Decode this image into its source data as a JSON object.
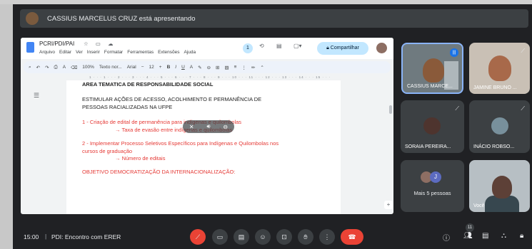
{
  "banner": {
    "text": "CASSIUS MARCELUS CRUZ está apresentando"
  },
  "doc": {
    "title": "PCRI/PDI/PAI",
    "menus": [
      "Arquivo",
      "Editar",
      "Ver",
      "Inserir",
      "Formatar",
      "Ferramentas",
      "Extensões",
      "Ajuda"
    ],
    "badge": "1",
    "share_label": "Compartilhar",
    "toolbar": {
      "zoom": "100%",
      "style": "Texto nor...",
      "font": "Arial",
      "size": "12"
    },
    "ruler": "1 · · · 1 · · · 2 · · · 3 · · · 4 · · · 5 · · · 6 · · · 7 · · · 8 · · · 9 · · · 10 · · · 11 · · · 12 · · · 13 · · · 14 · · · 15 · · · 16 · · · 17 · · · 18",
    "lines": [
      "AREA TEMATICA DE RESPONSABILIDADE SOCIAL",
      "ESTIMULAR AÇÕES DE ACESSO, ACOLHIMENTO E PERMANÊNCIA DE",
      "PESSOAS RACIALIZADAS NA UFPE",
      "1 - Criação de edital de permanência para indígenas e quilombolas",
      "→ Taxa de evasão entre indígenas e quilombolas",
      "2 - Implementar Processo Seletivos Específicos para Indígenas e Quilombolas nos",
      "cursos de graduação",
      "→ Número de editais",
      "OBJETIVO DEMOCRATIZAÇÃO DA INTERNACIONALIZAÇÃO:"
    ]
  },
  "participants": {
    "cassius": "CASSIUS MARCE...",
    "jamine": "JAMINE BRUNO ...",
    "soraia": "SORAIA PEREIRA...",
    "inacio": "INÁCIO ROBSO...",
    "more": "Mais 5 pessoas",
    "more_initial": "J",
    "you": "Você"
  },
  "bottom": {
    "time": "15:00",
    "separator": "|",
    "meeting_name": "PDI: Encontro com ERER",
    "people_count": "11"
  },
  "colors": {
    "accent": "#8ab4f8",
    "end_call": "#ea4335",
    "doc_red": "#e53935"
  }
}
